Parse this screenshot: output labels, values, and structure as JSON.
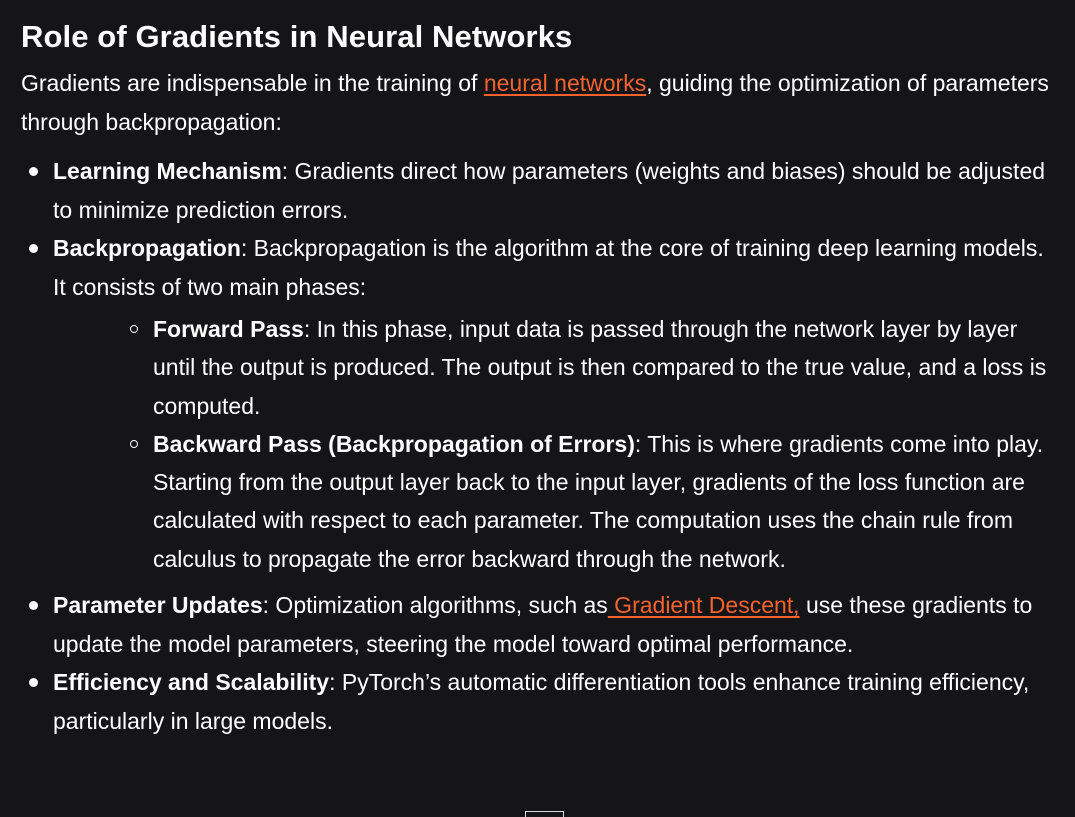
{
  "heading": "Role of Gradients in Neural Networks",
  "intro": {
    "before": "Gradients are indispensable in the training of ",
    "link": "neural networks",
    "after": ", guiding the optimization of parameters through backpropagation:"
  },
  "items": [
    {
      "term": "Learning Mechanism",
      "text": ": Gradients direct how parameters (weights and biases) should be adjusted to minimize prediction errors."
    },
    {
      "term": "Backpropagation",
      "text": ": Backpropagation is the algorithm at the core of training deep learning models. It consists of two main phases:",
      "subitems": [
        {
          "term": "Forward Pass",
          "text": ": In this phase, input data is passed through the network layer by layer until the output is produced. The output is then compared to the true value, and a loss is computed."
        },
        {
          "term": "Backward Pass (Backpropagation of Errors)",
          "text": ": This is where gradients come into play. Starting from the output layer back to the input layer, gradients of the loss function are calculated with respect to each parameter. The computation uses the chain rule from calculus to propagate the error backward through the network."
        }
      ]
    },
    {
      "term": "Parameter Updates",
      "before": ": Optimization algorithms, such as",
      "link": " Gradient Descent,",
      "after": " use these gradients to update the model parameters, steering the model toward optimal performance."
    },
    {
      "term": "Efficiency and Scalability",
      "text": ": PyTorch’s automatic differentiation tools enhance training efficiency, particularly in large models."
    }
  ],
  "colors": {
    "background": "#151518",
    "text": "#ffffff",
    "link": "#f4622e"
  }
}
